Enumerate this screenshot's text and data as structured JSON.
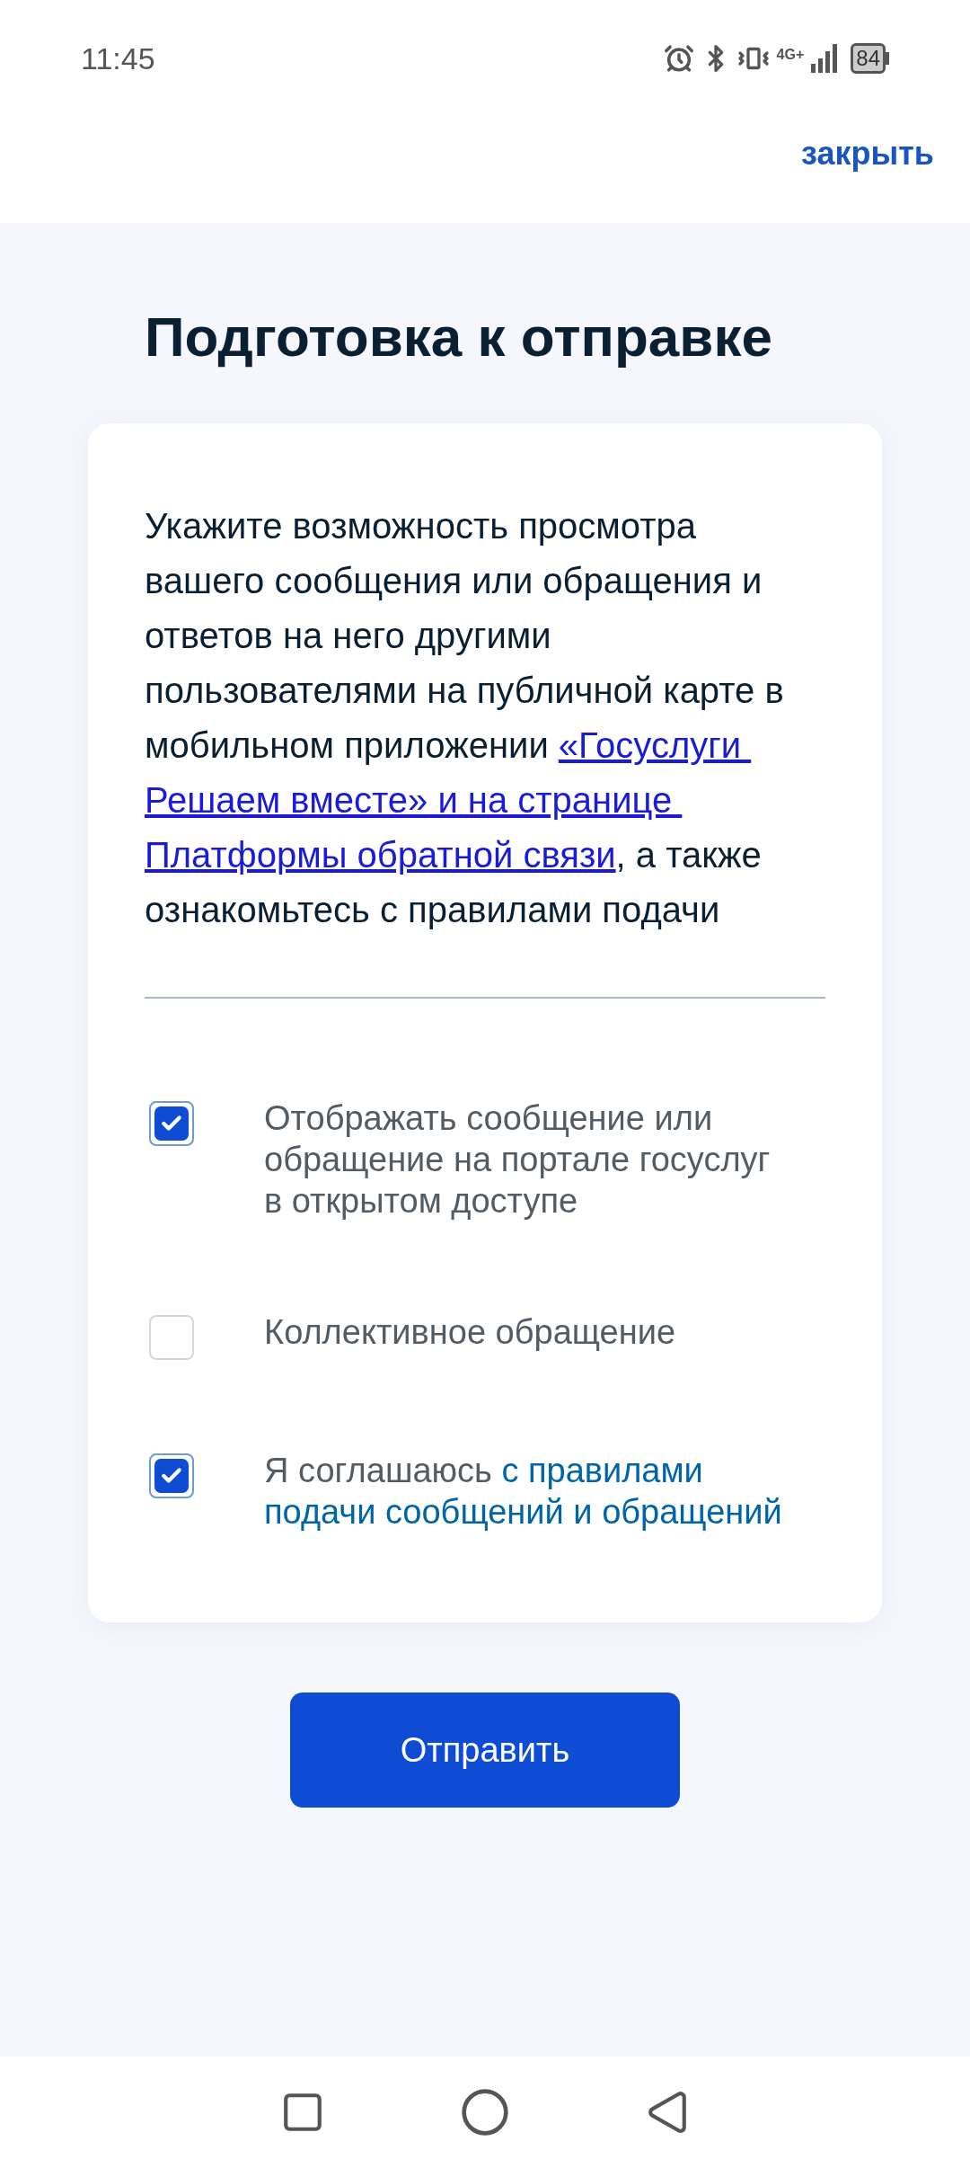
{
  "status_bar": {
    "time": "11:45",
    "network": "4G+",
    "battery": "84"
  },
  "header": {
    "close": "закрыть"
  },
  "title": "Подготовка к отправке",
  "intro": [
    {
      "kind": "text",
      "text": "Укажите возможность просмотра вашего сообщения или обращения и ответов на него другими пользователями на публичной карте в мобильном приложении "
    },
    {
      "kind": "link",
      "text": "«Госуслуги "
    },
    {
      "kind": "link",
      "text": "Решаем вместе» и на странице "
    },
    {
      "kind": "link",
      "text": "Платформы обратной связи"
    },
    {
      "kind": "text",
      "text": ", а также ознакомьтесь с правилами подачи"
    }
  ],
  "options": [
    {
      "checked": true,
      "label": [
        {
          "kind": "text",
          "text": "Отображать сообщение или обращение на портале госуслуг в открытом доступе"
        }
      ]
    },
    {
      "checked": false,
      "label": [
        {
          "kind": "text",
          "text": "Коллективное обращение"
        }
      ]
    },
    {
      "checked": true,
      "label": [
        {
          "kind": "text",
          "text": "Я соглашаюсь "
        },
        {
          "kind": "link",
          "text": "с правилами "
        },
        {
          "kind": "link",
          "text": "подачи сообщений и "
        },
        {
          "kind": "link",
          "text": "обращений"
        }
      ]
    }
  ],
  "submit": "Отправить"
}
